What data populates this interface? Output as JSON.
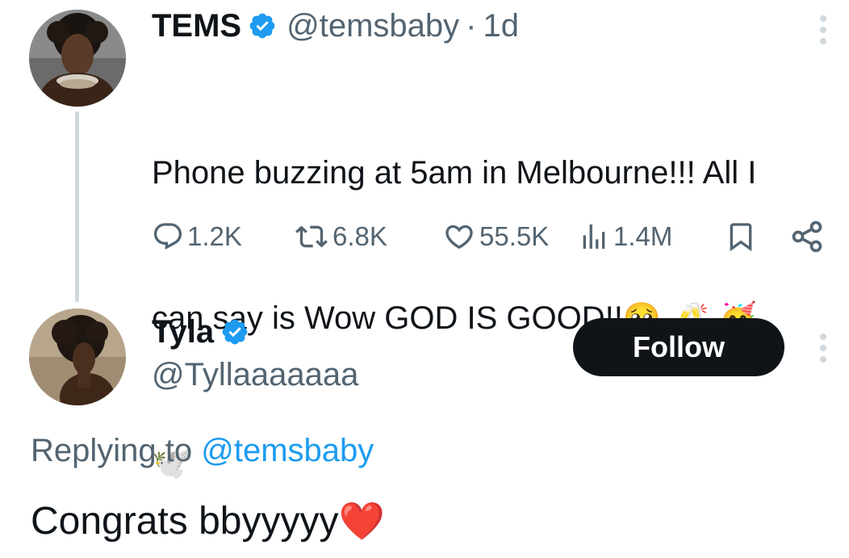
{
  "colors": {
    "text_primary": "#0f1419",
    "text_secondary": "#536471",
    "accent": "#1d9bf0",
    "verified": "#1d9bf0",
    "follow_bg": "#0f1419",
    "follow_text": "#ffffff",
    "thread_line": "#cfd9de"
  },
  "original_tweet": {
    "display_name": "TEMS",
    "verified": true,
    "handle": "@temsbaby",
    "separator": "·",
    "time": "1d",
    "text_lines": [
      "Phone buzzing at 5am in Melbourne!!! All I",
      "can say is Wow GOD IS GOOD!!",
      ""
    ],
    "emoji_line2": "🥹 🥂 🥳",
    "emoji_line3": "🕊️",
    "icons": {
      "avatar": "avatar-tems",
      "more": "more-vertical-icon",
      "verified": "verified-badge-icon"
    },
    "actions": {
      "replies": "1.2K",
      "reposts": "6.8K",
      "likes": "55.5K",
      "views": "1.4M"
    }
  },
  "reply_tweet": {
    "display_name": "Tyla",
    "verified": true,
    "handle": "@Tyllaaaaaaa",
    "follow_label": "Follow",
    "replying_label": "Replying to",
    "replying_handle": "@temsbaby",
    "text": "Congrats bbyyyyy",
    "text_emoji": "❤️"
  }
}
